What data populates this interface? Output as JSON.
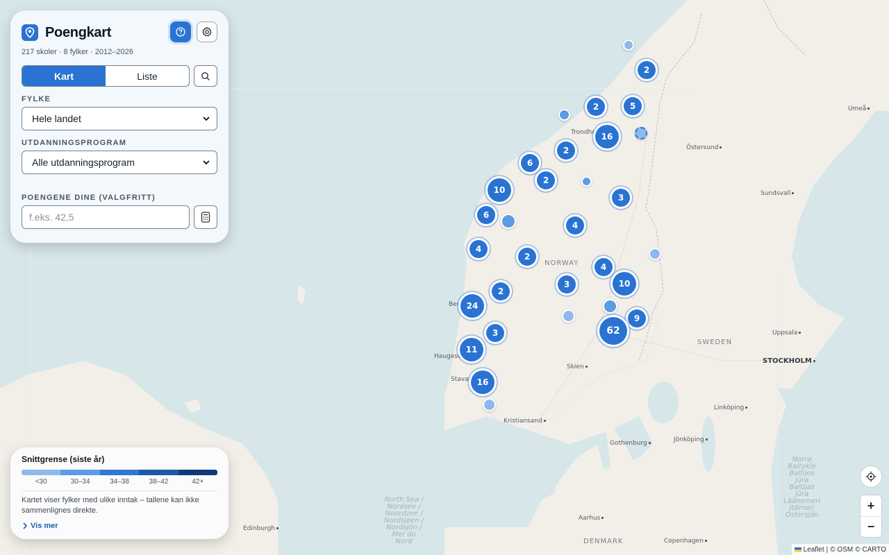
{
  "app": {
    "title": "Poengkart",
    "meta": "217 skoler · 8 fylker · 2012–2026"
  },
  "view_toggle": {
    "map_label": "Kart",
    "list_label": "Liste",
    "active": "Kart"
  },
  "filters": {
    "county_label": "FYLKE",
    "county_value": "Hele landet",
    "program_label": "UTDANNINGSPROGRAM",
    "program_value": "Alle utdanningsprogram",
    "points_label": "POENGENE DINE (VALGFRITT)",
    "points_placeholder": "f.eks. 42,5"
  },
  "legend": {
    "title": "Snittgrense (siste år)",
    "colors": [
      "#8fb9ec",
      "#5d9be4",
      "#2f79d4",
      "#1d59a8",
      "#0f3a78"
    ],
    "ticks": [
      "<30",
      "30–34",
      "34–38",
      "38–42",
      "42+"
    ],
    "note": "Kartet viser fylker med ulike inntak – tallene kan ikke sammenlignes direkte.",
    "more_label": "Vis mer"
  },
  "map": {
    "places": [
      {
        "name": "Umeå",
        "dot": true
      },
      {
        "name": "Östersund",
        "dot": true
      },
      {
        "name": "Sundsvall",
        "dot": true
      },
      {
        "name": "Trondheim",
        "dot": false
      },
      {
        "name": "NORWAY",
        "dot": false
      },
      {
        "name": "SWEDEN",
        "dot": false
      },
      {
        "name": "Uppsala",
        "dot": true
      },
      {
        "name": "STOCKHOLM",
        "dot": true
      },
      {
        "name": "Bergen",
        "dot": false
      },
      {
        "name": "Haugesund",
        "dot": false
      },
      {
        "name": "Stavanger",
        "dot": false
      },
      {
        "name": "Skien",
        "dot": true
      },
      {
        "name": "Kristiansand",
        "dot": true
      },
      {
        "name": "Linköping",
        "dot": true
      },
      {
        "name": "Gothenburg",
        "dot": true
      },
      {
        "name": "Jönköping",
        "dot": true
      },
      {
        "name": "Aarhus",
        "dot": true
      },
      {
        "name": "DENMARK",
        "dot": false
      },
      {
        "name": "Copenhagen",
        "dot": true
      },
      {
        "name": "Edinburgh",
        "dot": true
      },
      {
        "name": "Norra Baltic",
        "dot": false
      },
      {
        "name": "North Sea / Nordsee / Nordsjøen / Noordzee / Nordsjön / Mer du Nord",
        "dot": false
      },
      {
        "name": "Östersjön",
        "dot": false
      }
    ],
    "sea_north": "North Sea /\nNordsee /\nNoordzee /\nNordsjøen /\nNordsjön /\nMer du\nNord",
    "sea_baltic": "Norra\nBaltykle\nBaltijos\njūra\nBaltijas\njūra\nLäänemeri\nItämeri\nÖstersjön",
    "clusters": [
      {
        "count": "2"
      },
      {
        "count": "2"
      },
      {
        "count": "5"
      },
      {
        "count": "16"
      },
      {
        "count": "2"
      },
      {
        "count": "6"
      },
      {
        "count": "2"
      },
      {
        "count": "10"
      },
      {
        "count": "3"
      },
      {
        "count": "6"
      },
      {
        "count": "4"
      },
      {
        "count": "4"
      },
      {
        "count": "2"
      },
      {
        "count": "4"
      },
      {
        "count": "10"
      },
      {
        "count": "3"
      },
      {
        "count": "2"
      },
      {
        "count": "24"
      },
      {
        "count": "9"
      },
      {
        "count": "62"
      },
      {
        "count": "3"
      },
      {
        "count": "11"
      },
      {
        "count": "16"
      }
    ]
  },
  "attribution": {
    "leaflet": "Leaflet",
    "osm": "© OSM",
    "carto": "© CARTO",
    "sep": "|"
  }
}
